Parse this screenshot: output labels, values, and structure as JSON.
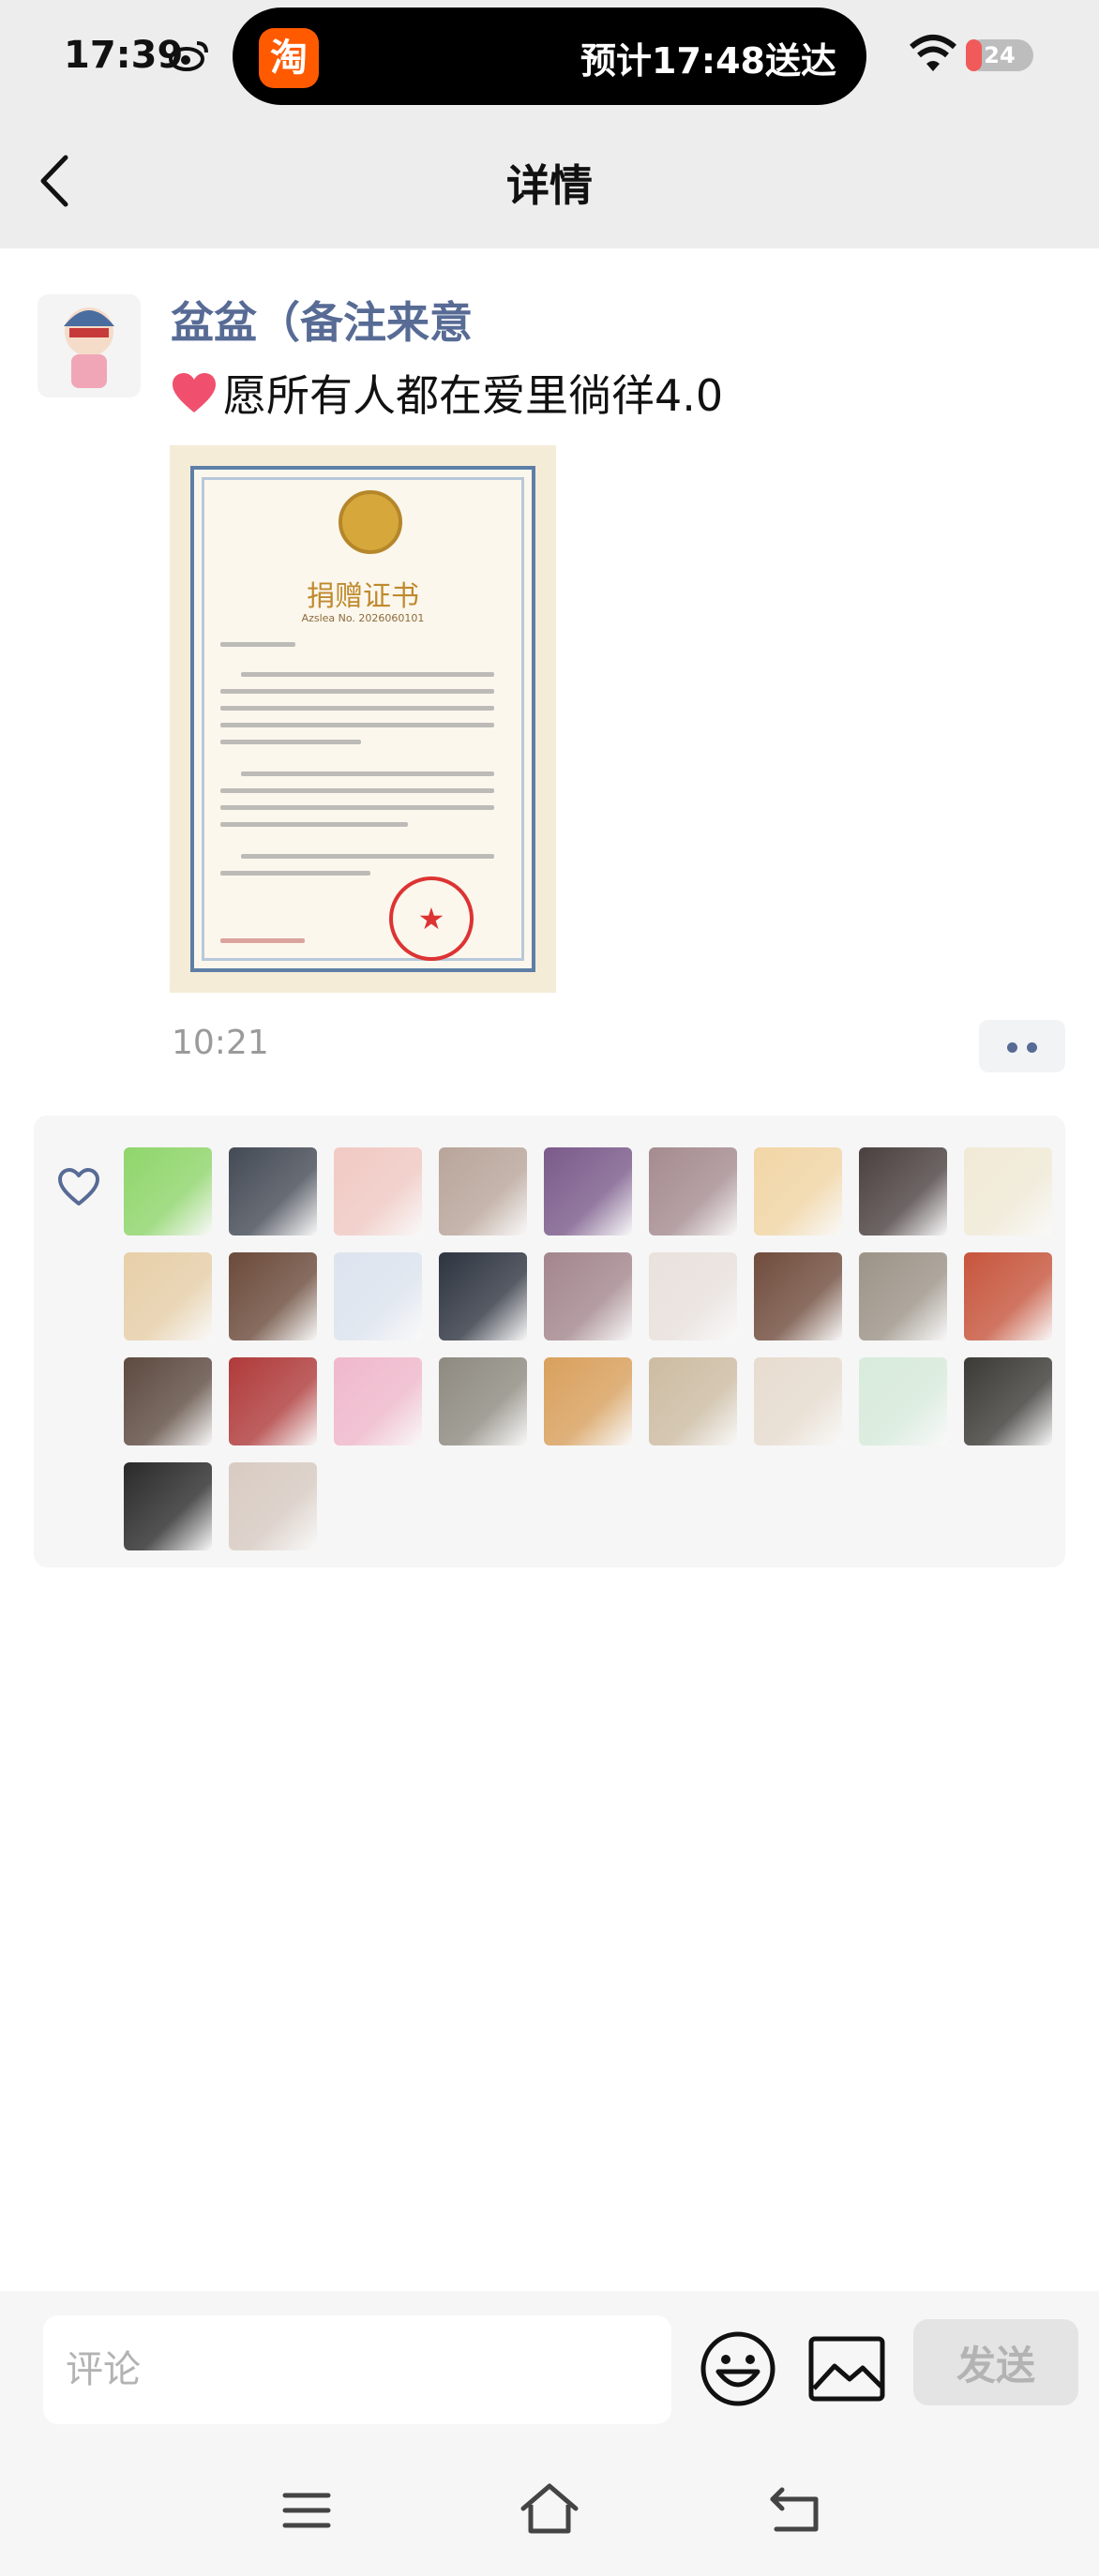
{
  "status_bar": {
    "time": "17:39",
    "island_app_glyph": "淘",
    "island_text": "预计17:48送达",
    "battery": "24",
    "battery_level": 0.24
  },
  "nav": {
    "title": "详情"
  },
  "post": {
    "username": "盆盆（备注来意",
    "text": "愿所有人都在爱里徜徉4.0",
    "image": {
      "title": "捐赠证书",
      "number": "Azslea No. 2026060101"
    },
    "time": "10:21"
  },
  "likes": {
    "avatars": [
      {
        "name": "heart-sticker",
        "color": "#8fd66a"
      },
      {
        "name": "long-hair-girl",
        "color": "#444a55"
      },
      {
        "name": "cartoon-sheep",
        "color": "#f1c9c3"
      },
      {
        "name": "cat-hat",
        "color": "#b9a59a"
      },
      {
        "name": "purple-cat",
        "color": "#7a5a8a"
      },
      {
        "name": "horse",
        "color": "#a58b8f"
      },
      {
        "name": "bunny-girl",
        "color": "#f2d6a5"
      },
      {
        "name": "man-portrait",
        "color": "#4b4040"
      },
      {
        "name": "cartoon-doll",
        "color": "#f1ead6"
      },
      {
        "name": "blonde-girl",
        "color": "#e7cfa8"
      },
      {
        "name": "sunset-silhouette",
        "color": "#6b4a3a"
      },
      {
        "name": "work-cat",
        "color": "#dde4ef"
      },
      {
        "name": "rabbit-dark",
        "color": "#2e3440"
      },
      {
        "name": "doll-face",
        "color": "#a3868d"
      },
      {
        "name": "white-cat-girl",
        "color": "#e9e1dd"
      },
      {
        "name": "sunset-silhouette-2",
        "color": "#704c3c"
      },
      {
        "name": "grey-cat",
        "color": "#9c9387"
      },
      {
        "name": "cake-bird",
        "color": "#c7553c"
      },
      {
        "name": "sunglasses-woman",
        "color": "#5d4a40"
      },
      {
        "name": "red-hair-girl",
        "color": "#b03a3a"
      },
      {
        "name": "pink-cartoon",
        "color": "#f0b8cc"
      },
      {
        "name": "cat-beanie",
        "color": "#8e8a80"
      },
      {
        "name": "orange-cat",
        "color": "#d9a05c"
      },
      {
        "name": "glasses-cat",
        "color": "#cdbca2"
      },
      {
        "name": "white-kitten",
        "color": "#e7dccf"
      },
      {
        "name": "cartoon-bear",
        "color": "#d7ebdc"
      },
      {
        "name": "dark-room",
        "color": "#3c3a36"
      },
      {
        "name": "boy-portrait",
        "color": "#2a2a2a"
      },
      {
        "name": "selfie-girl",
        "color": "#d8cbc2"
      }
    ]
  },
  "composer": {
    "placeholder": "评论",
    "send_label": "发送"
  }
}
